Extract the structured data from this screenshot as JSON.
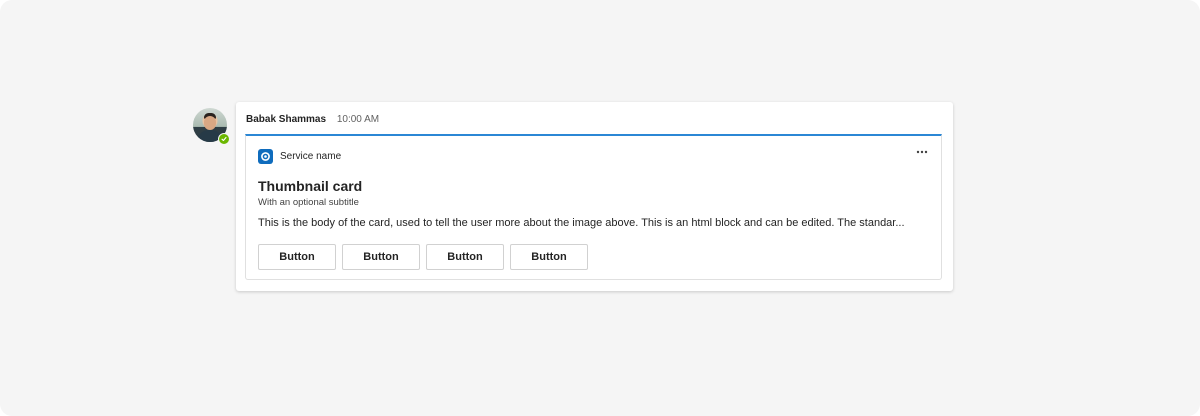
{
  "message": {
    "author": "Babak Shammas",
    "timestamp": "10:00 AM",
    "presence": "available"
  },
  "card": {
    "service_icon": "service-ring-icon",
    "service_name": "Service name",
    "more_icon": "more-horizontal-icon",
    "title": "Thumbnail card",
    "subtitle": "With an optional subtitle",
    "body": "This is the body of the card, used to tell the user more about the image above. This is an html block and can be edited. The standar...",
    "buttons": [
      {
        "label": "Button"
      },
      {
        "label": "Button"
      },
      {
        "label": "Button"
      },
      {
        "label": "Button"
      }
    ]
  },
  "colors": {
    "background": "#f5f5f5",
    "accent": "#2b87d5",
    "presence_available": "#6bb700",
    "service_icon_bg": "#0f6cbd"
  }
}
